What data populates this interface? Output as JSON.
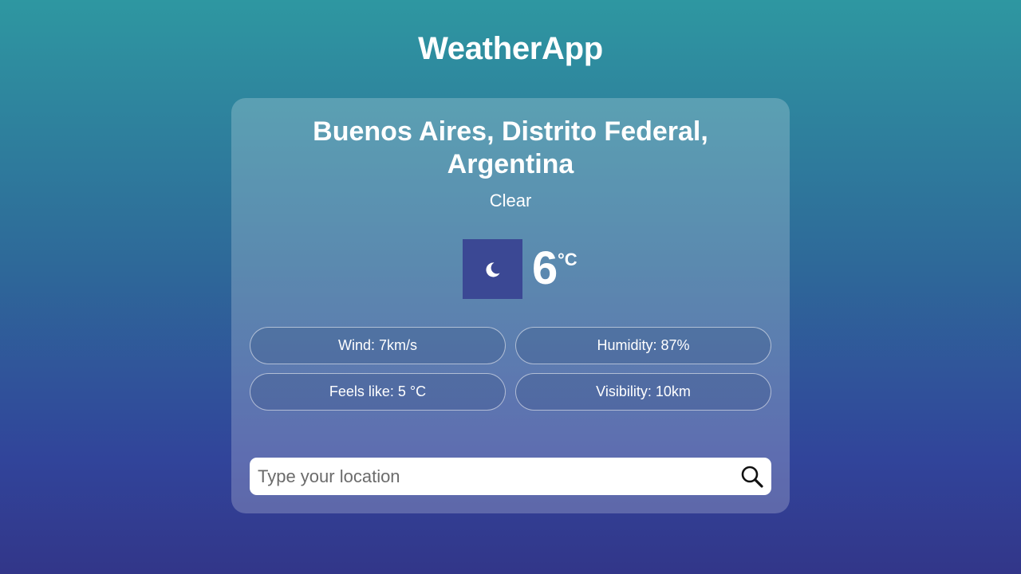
{
  "app": {
    "title": "WeatherApp"
  },
  "weather": {
    "location": "Buenos Aires, Distrito Federal, Argentina",
    "condition": "Clear",
    "icon": "moon-icon",
    "icon_bg_color": "#3b4894",
    "temperature": "6",
    "unit": "°C",
    "stats": {
      "wind": "Wind: 7km/s",
      "humidity": "Humidity: 87%",
      "feels_like": "Feels like: 5 °C",
      "visibility": "Visibility: 10km"
    }
  },
  "search": {
    "placeholder": "Type your location",
    "value": "",
    "icon": "search-icon"
  },
  "colors": {
    "background_top": "#2e97a1",
    "background_bottom": "#323689",
    "text": "#ffffff"
  }
}
